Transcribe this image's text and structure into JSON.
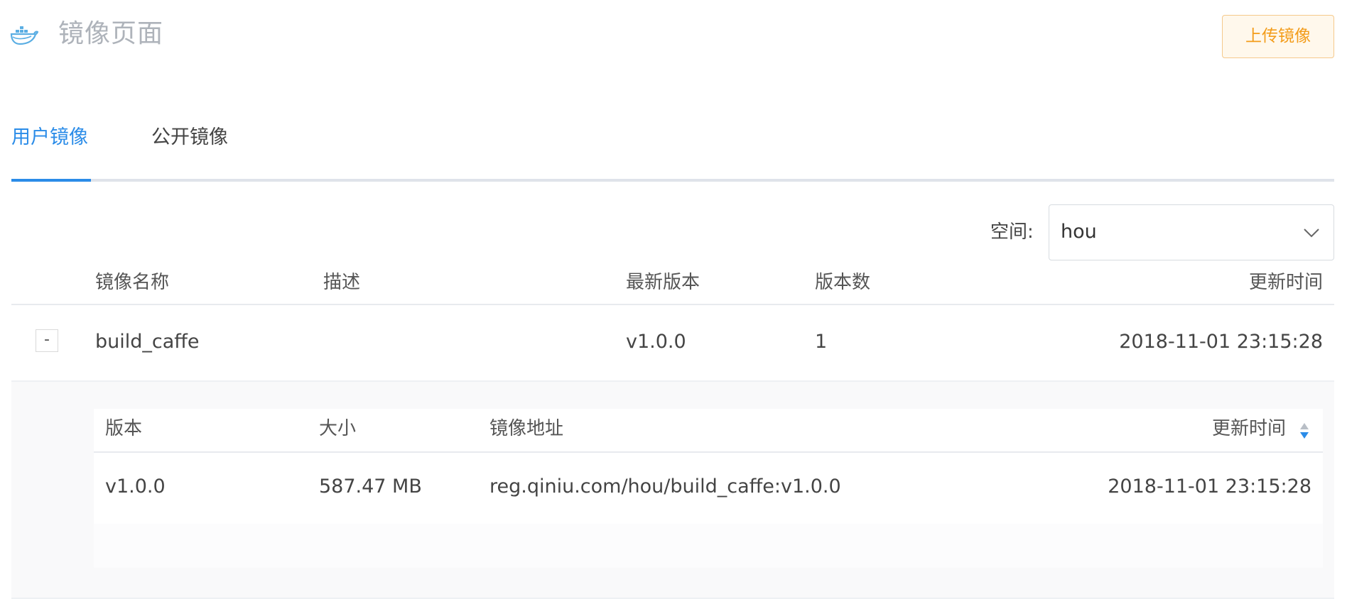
{
  "header": {
    "title": "镜像页面",
    "upload_button": "上传镜像",
    "logo_icon": "docker-whale-icon"
  },
  "tabs": [
    {
      "label": "用户镜像",
      "active": true
    },
    {
      "label": "公开镜像",
      "active": false
    }
  ],
  "space": {
    "label": "空间:",
    "selected": "hou"
  },
  "images_table": {
    "columns": [
      "镜像名称",
      "描述",
      "最新版本",
      "版本数",
      "更新时间"
    ],
    "rows": [
      {
        "expand_toggle": "-",
        "name": "build_caffe",
        "description": "",
        "latest_version": "v1.0.0",
        "version_count": "1",
        "updated_at": "2018-11-01 23:15:28"
      }
    ]
  },
  "versions_table": {
    "columns": [
      "版本",
      "大小",
      "镜像地址",
      "更新时间"
    ],
    "sort_icon": "sort-caret-icon",
    "rows": [
      {
        "version": "v1.0.0",
        "size": "587.47 MB",
        "address": "reg.qiniu.com/hou/build_caffe:v1.0.0",
        "updated_at": "2018-11-01 23:15:28"
      }
    ]
  },
  "colors": {
    "accent": "#2b8ce8",
    "upload_text": "#f39c1a",
    "upload_border": "#f5c98b",
    "upload_bg": "#fff8ec",
    "title": "#aeb3ba"
  }
}
